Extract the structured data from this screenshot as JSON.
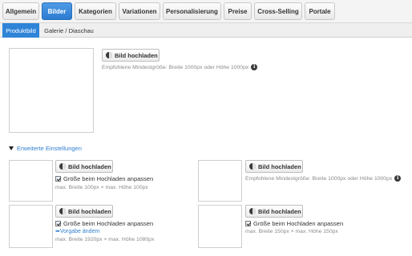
{
  "top_tabs": [
    {
      "label": "Allgemein",
      "active": false
    },
    {
      "label": "Bilder",
      "active": true
    },
    {
      "label": "Kategorien",
      "active": false
    },
    {
      "label": "Variationen",
      "active": false
    },
    {
      "label": "Personalisierung",
      "active": false
    },
    {
      "label": "Preise",
      "active": false
    },
    {
      "label": "Cross-Selling",
      "active": false
    },
    {
      "label": "Portale",
      "active": false
    }
  ],
  "sub_tabs": [
    {
      "label": "Produktbild",
      "active": true
    },
    {
      "label": "Galerie / Diaschau",
      "active": false
    }
  ],
  "main": {
    "upload_label": "Bild hochladen",
    "hint": "Empfohlene Mindestgröße: Breite 1000px oder Höhe 1000px"
  },
  "advanced": {
    "label": "Erweiterte Einstellungen",
    "slots": [
      {
        "upload_label": "Bild hochladen",
        "checkbox_label": "Größe beim Hochladen anpassen",
        "checked": true,
        "link": "",
        "size": "max. Breite 100px × max. Höhe 100px"
      },
      {
        "upload_label": "Bild hochladen",
        "hint": "Empfohlene Mindestgröße: Breite 1000px oder Höhe 1000px"
      },
      {
        "upload_label": "Bild hochladen",
        "checkbox_label": "Größe beim Hochladen anpassen",
        "checked": true,
        "link": "Vorgabe ändern",
        "size": "max. Breite 1920px × max. Höhe 1080px"
      },
      {
        "upload_label": "Bild hochladen",
        "checkbox_label": "Größe beim Hochladen anpassen",
        "checked": true,
        "size": "max. Breite 150px × max. Höhe 150px"
      }
    ]
  },
  "icons": {
    "upload": "camera-icon",
    "info": "info-icon",
    "expand": "triangle-down-icon"
  },
  "colors": {
    "accent": "#2f84d8",
    "link": "#2f7fd0"
  }
}
